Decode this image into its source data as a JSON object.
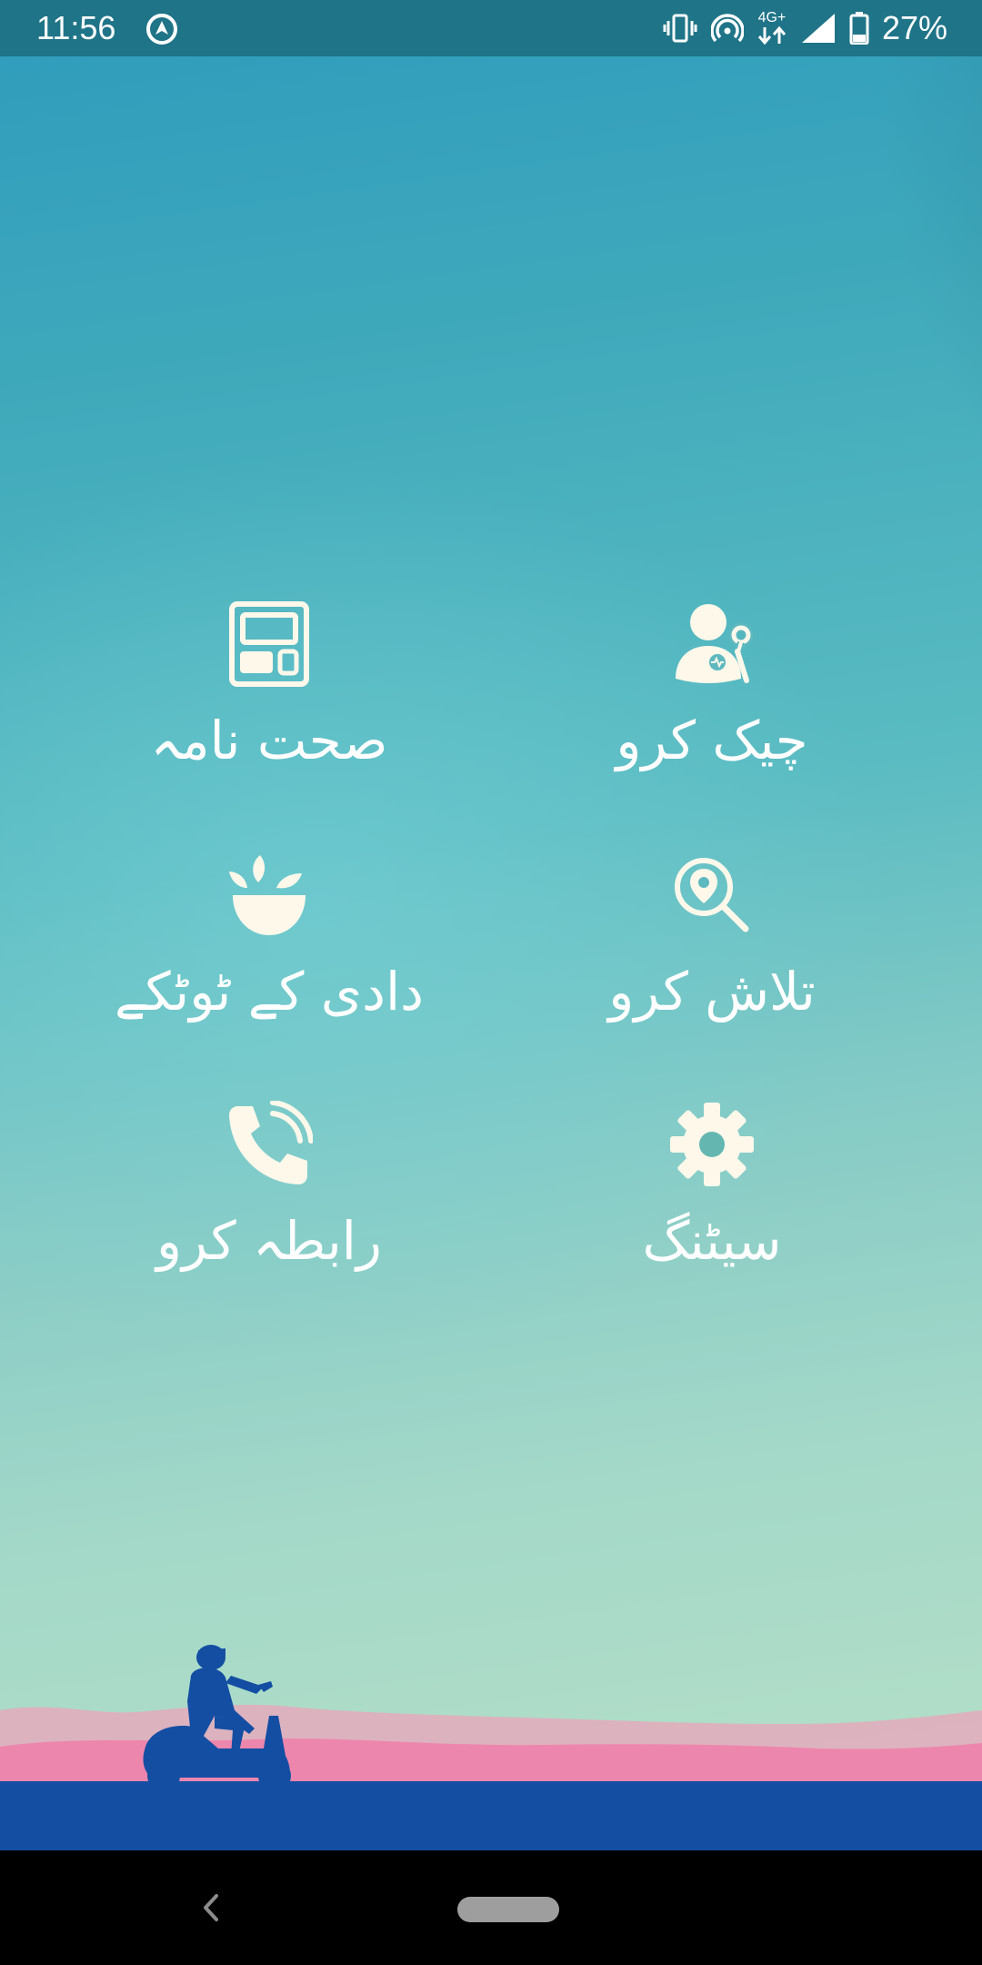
{
  "status_bar": {
    "time": "11:56",
    "network": "4G+",
    "battery": "27%",
    "icons": [
      "location-icon",
      "vibrate-icon",
      "hotspot-icon",
      "signal-icon",
      "battery-icon"
    ]
  },
  "menu": {
    "health_record": {
      "label": "صحت نامہ",
      "icon": "health-record-icon"
    },
    "checkup": {
      "label": "چیک کرو",
      "icon": "doctor-icon"
    },
    "remedies": {
      "label": "دادی کے ٹوٹکے",
      "icon": "herbal-bowl-icon"
    },
    "search": {
      "label": "تلاش کرو",
      "icon": "location-search-icon"
    },
    "contact": {
      "label": "رابطہ کرو",
      "icon": "phone-icon"
    },
    "settings": {
      "label": "سیٹنگ",
      "icon": "gear-icon"
    }
  },
  "colors": {
    "status_bar": "#1f7488",
    "icon_fill": "#fdf8ea",
    "ground": "#144ea3",
    "hills": "#e98fb0",
    "nav_bar": "#000000"
  }
}
